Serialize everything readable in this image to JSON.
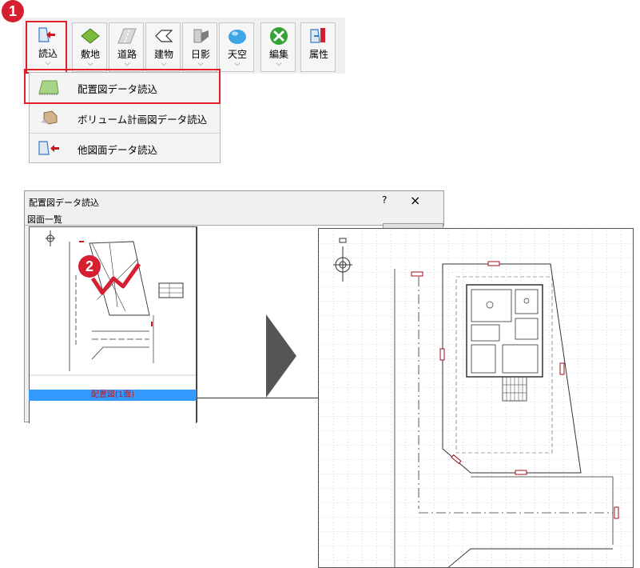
{
  "toolbar": {
    "buttons": [
      {
        "label": "読込",
        "icon": "import-icon"
      },
      {
        "label": "敷地",
        "icon": "site-icon"
      },
      {
        "label": "道路",
        "icon": "road-icon"
      },
      {
        "label": "建物",
        "icon": "building-icon"
      },
      {
        "label": "日影",
        "icon": "shadow-icon"
      },
      {
        "label": "天空",
        "icon": "sky-icon"
      },
      {
        "label": "編集",
        "icon": "edit-icon"
      },
      {
        "label": "属性",
        "icon": "attribute-icon"
      }
    ],
    "chevron": "⌵"
  },
  "step_badges": {
    "one": "1",
    "two": "2"
  },
  "dropdown": {
    "items": [
      {
        "label": "配置図データ読込",
        "icon": "site-plan-icon"
      },
      {
        "label": "ボリューム計画図データ読込",
        "icon": "volume-plan-icon"
      },
      {
        "label": "他図面データ読込",
        "icon": "other-drawing-icon"
      }
    ]
  },
  "dialog": {
    "title": "配置図データ読込",
    "help": "?",
    "close": "×",
    "section_label": "図面一覧",
    "thumbnail_caption": "配置図(1面)"
  },
  "colors": {
    "highlight": "#e0202a",
    "badge": "#d42030",
    "selection": "#3399ff",
    "arrow": "#555555"
  }
}
